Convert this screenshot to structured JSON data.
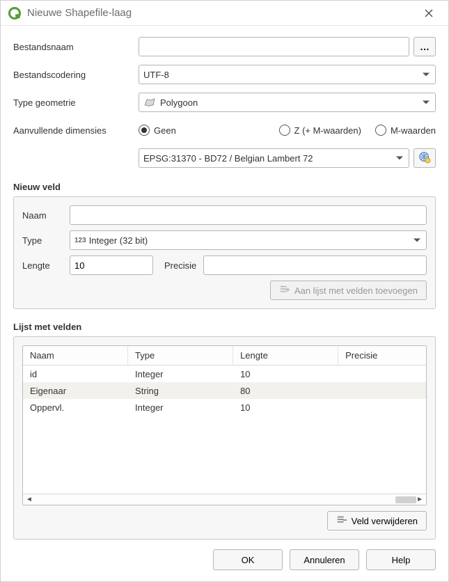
{
  "window": {
    "title": "Nieuwe Shapefile-laag"
  },
  "form": {
    "filename_label": "Bestandsnaam",
    "filename_value": "",
    "browse_label": "…",
    "encoding_label": "Bestandscodering",
    "encoding_value": "UTF-8",
    "geomtype_label": "Type geometrie",
    "geomtype_value": "Polygoon",
    "dims_label": "Aanvullende dimensies",
    "dims": {
      "none": "Geen",
      "zm": "Z (+ M-waarden)",
      "m": "M-waarden",
      "selected": "none"
    },
    "crs_value": "EPSG:31370 - BD72 / Belgian Lambert 72"
  },
  "newfield": {
    "legend": "Nieuw veld",
    "name_label": "Naam",
    "name_value": "",
    "type_label": "Type",
    "type_prefix": "123",
    "type_value": "Integer (32 bit)",
    "length_label": "Lengte",
    "length_value": "10",
    "precision_label": "Precisie",
    "precision_value": "",
    "add_button": "Aan lijst met velden toevoegen"
  },
  "fieldlist": {
    "legend": "Lijst met velden",
    "columns": {
      "name": "Naam",
      "type": "Type",
      "length": "Lengte",
      "precision": "Precisie"
    },
    "rows": [
      {
        "name": "id",
        "type": "Integer",
        "length": "10",
        "precision": ""
      },
      {
        "name": "Eigenaar",
        "type": "String",
        "length": "80",
        "precision": ""
      },
      {
        "name": "Oppervl.",
        "type": "Integer",
        "length": "10",
        "precision": ""
      }
    ],
    "remove_button": "Veld verwijderen"
  },
  "buttons": {
    "ok": "OK",
    "cancel": "Annuleren",
    "help": "Help"
  }
}
